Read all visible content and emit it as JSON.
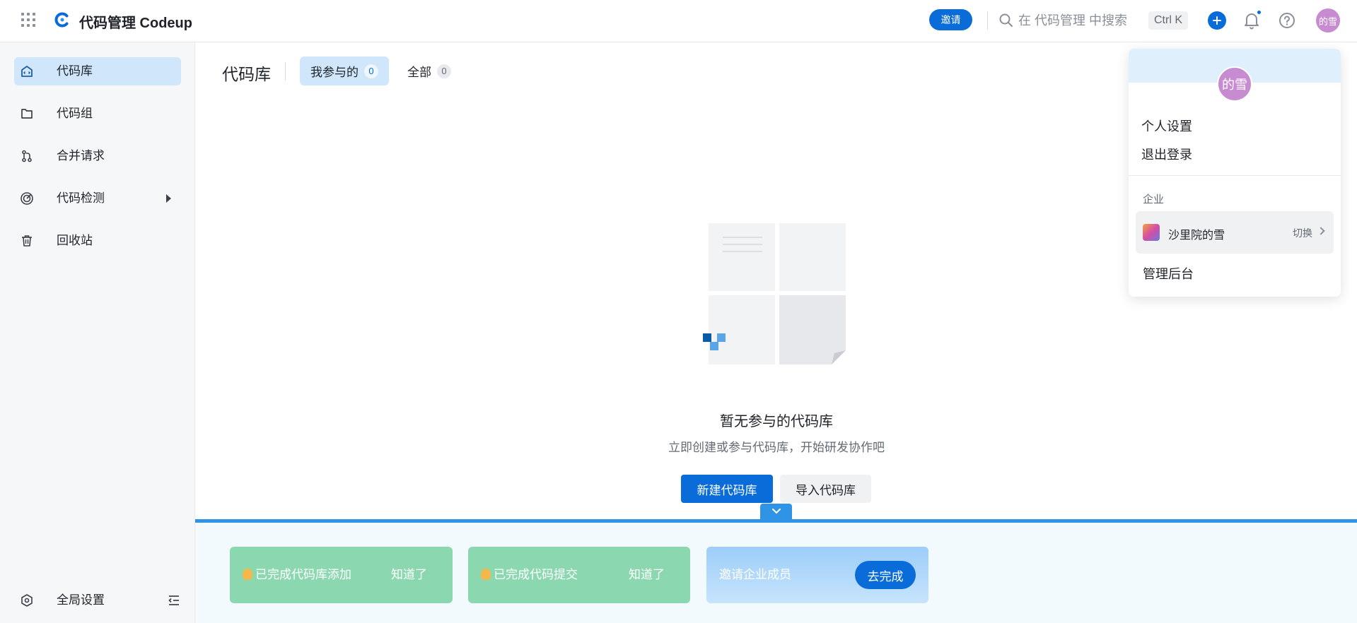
{
  "header": {
    "app_title": "代码管理 Codeup",
    "invite_label": "邀请",
    "search_placeholder": "在 代码管理 中搜索",
    "shortcut": "Ctrl K",
    "avatar_text": "的雪",
    "icons": [
      "apps-grid-icon",
      "codeup-logo-icon",
      "search-icon",
      "plus-icon",
      "bell-icon",
      "help-icon"
    ]
  },
  "sidebar": {
    "items": [
      {
        "label": "代码库",
        "icon": "repo-icon",
        "active": true
      },
      {
        "label": "代码组",
        "icon": "folder-icon"
      },
      {
        "label": "合并请求",
        "icon": "merge-request-icon"
      },
      {
        "label": "代码检测",
        "icon": "code-scan-icon",
        "expandable": true
      },
      {
        "label": "回收站",
        "icon": "trash-icon"
      }
    ],
    "settings_label": "全局设置"
  },
  "main": {
    "page_title": "代码库",
    "tabs": [
      {
        "label": "我参与的",
        "count": "0",
        "active": true
      },
      {
        "label": "全部",
        "count": "0"
      }
    ],
    "empty_title": "暂无参与的代码库",
    "empty_desc": "立即创建或参与代码库，开始研发协作吧",
    "create_btn": "新建代码库",
    "import_btn": "导入代码库"
  },
  "tasks": [
    {
      "text": "已完成代码库添加",
      "action": "知道了",
      "status": "done"
    },
    {
      "text": "已完成代码提交",
      "action": "知道了",
      "status": "done"
    },
    {
      "text": "邀请企业成员",
      "action": "去完成",
      "status": "todo"
    }
  ],
  "user_menu": {
    "avatar_text": "的雪",
    "personal_settings": "个人设置",
    "logout": "退出登录",
    "section_org": "企业",
    "org_name": "沙里院的雪",
    "org_switch": "切换",
    "admin": "管理后台"
  },
  "colors": {
    "primary": "#0a6cd8",
    "sidebar_active": "#cfe6fb",
    "task_done": "#8bd8b0",
    "avatar": "#c78bd1"
  }
}
